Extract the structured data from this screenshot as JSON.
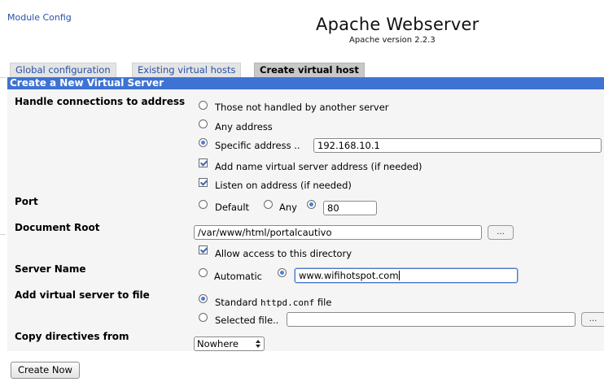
{
  "header": {
    "module_config_link": "Module Config",
    "title": "Apache Webserver",
    "subtitle": "Apache version 2.2.3"
  },
  "tabs": [
    {
      "label": "Global configuration",
      "active": false
    },
    {
      "label": "Existing virtual hosts",
      "active": false
    },
    {
      "label": "Create virtual host",
      "active": true
    }
  ],
  "form": {
    "section_title": "Create a New Virtual Server",
    "address": {
      "label": "Handle connections to address",
      "options": [
        "Those not handled by another server",
        "Any address",
        "Specific address .."
      ],
      "selected": "Specific address ..",
      "specific_value": "192.168.10.1",
      "add_name_virtual": {
        "label": "Add name virtual server address (if needed)",
        "checked": true
      },
      "listen": {
        "label": "Listen on address (if needed)",
        "checked": true
      }
    },
    "port": {
      "label": "Port",
      "options": [
        "Default",
        "Any"
      ],
      "selected": "custom",
      "value": "80"
    },
    "docroot": {
      "label": "Document Root",
      "value": "/var/www/html/portalcautivo",
      "browse_label": "...",
      "allow_access": {
        "label": "Allow access to this directory",
        "checked": true
      }
    },
    "server_name": {
      "label": "Server Name",
      "options": [
        "Automatic"
      ],
      "selected": "custom",
      "value": "www.wifihotspot.com"
    },
    "add_to_file": {
      "label": "Add virtual server to file",
      "standard_label_pre": "Standard ",
      "standard_label_code": "httpd.conf",
      "standard_label_post": " file",
      "selected_file_label": "Selected file..",
      "selected": "standard",
      "file_value": "",
      "browse_label": "..."
    },
    "copy_directives": {
      "label": "Copy directives from",
      "value": "Nowhere"
    }
  },
  "actions": {
    "create_now": "Create Now"
  },
  "colors": {
    "section_bar": "#3f73d3",
    "link": "#2850a8"
  }
}
